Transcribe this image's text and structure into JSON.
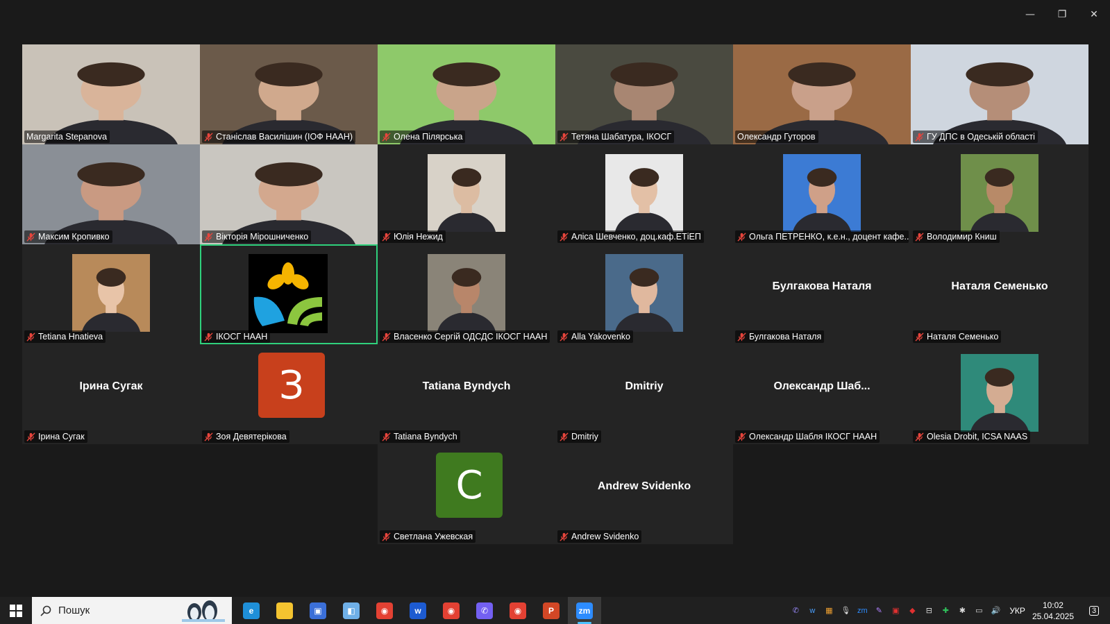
{
  "window": {
    "controls": [
      "minimize",
      "restore",
      "close"
    ]
  },
  "tiles": [
    {
      "row": 0,
      "col": 0,
      "name": "Margarita  Stepanova",
      "muted": false,
      "kind": "video",
      "bg": "#c9c2b8",
      "skin": "#d9b49a"
    },
    {
      "row": 0,
      "col": 1,
      "name": "Станіслав Василішин (ІОФ НААН)",
      "muted": true,
      "kind": "video",
      "bg": "#6b5a4a",
      "skin": "#d0a98d"
    },
    {
      "row": 0,
      "col": 2,
      "name": "Олена Пілярська",
      "muted": true,
      "kind": "video",
      "bg": "#8ec96a",
      "skin": "#c9a48a"
    },
    {
      "row": 0,
      "col": 3,
      "name": "Тетяна Шабатура, ІКОСГ",
      "muted": true,
      "kind": "video",
      "bg": "#4a4a40",
      "skin": "#a88672"
    },
    {
      "row": 0,
      "col": 4,
      "name": "Олександр Гуторов",
      "muted": false,
      "kind": "video",
      "bg": "#9a6a45",
      "skin": "#c9a08a"
    },
    {
      "row": 0,
      "col": 5,
      "name": "ГУ ДПС в Одеській області",
      "muted": true,
      "kind": "video",
      "bg": "#cfd6df",
      "skin": "#b58e78"
    },
    {
      "row": 1,
      "col": 0,
      "name": "Максим Кропивко",
      "muted": true,
      "kind": "video",
      "bg": "#8a8f96",
      "skin": "#c99a82"
    },
    {
      "row": 1,
      "col": 1,
      "name": "Вікторія Мірошниченко",
      "muted": true,
      "kind": "video",
      "bg": "#c9c6c0",
      "skin": "#d3a88e"
    },
    {
      "row": 1,
      "col": 2,
      "name": "Юлія Нежид",
      "muted": true,
      "kind": "photo",
      "bg": "#d8d2c8",
      "skin": "#dcbca2"
    },
    {
      "row": 1,
      "col": 3,
      "name": "Аліса Шевченко, доц.каф.ЕТіЕП",
      "muted": true,
      "kind": "photo",
      "bg": "#e8e8e8",
      "skin": "#e3c0a6"
    },
    {
      "row": 1,
      "col": 4,
      "name": "Ольга ПЕТРЕНКО, к.е.н., доцент кафе...",
      "muted": true,
      "kind": "photo",
      "bg": "#3c7bd4",
      "skin": "#cfa088"
    },
    {
      "row": 1,
      "col": 5,
      "name": "Володимир Книш",
      "muted": true,
      "kind": "photo",
      "bg": "#6f8f4a",
      "skin": "#b88a68"
    },
    {
      "row": 2,
      "col": 0,
      "name": "Tetiana Hnatieva",
      "muted": true,
      "kind": "photo",
      "bg": "#b88a5a",
      "skin": "#e8c4a8"
    },
    {
      "row": 2,
      "col": 1,
      "name": "ІКОСГ НААН",
      "muted": true,
      "kind": "logo",
      "active": true
    },
    {
      "row": 2,
      "col": 2,
      "name": "Власенко Сергій ОДСДС ІКОСГ НААН",
      "muted": true,
      "kind": "photo",
      "bg": "#8a8478",
      "skin": "#b8866a"
    },
    {
      "row": 2,
      "col": 3,
      "name": "Alla Yakovenko",
      "muted": true,
      "kind": "photo",
      "bg": "#4a6a8a",
      "skin": "#e0b89e"
    },
    {
      "row": 2,
      "col": 4,
      "name": "Булгакова Наталя",
      "muted": true,
      "kind": "name",
      "display": "Булгакова Наталя"
    },
    {
      "row": 2,
      "col": 5,
      "name": "Наталя Семенько",
      "muted": true,
      "kind": "name",
      "display": "Наталя Семенько"
    },
    {
      "row": 3,
      "col": 0,
      "name": "Ірина Сугак",
      "muted": true,
      "kind": "name",
      "display": "Ірина Сугак"
    },
    {
      "row": 3,
      "col": 1,
      "name": "Зоя Девятерікова",
      "muted": true,
      "kind": "avatar",
      "letter": "З",
      "avatar_color": "#c8401c"
    },
    {
      "row": 3,
      "col": 2,
      "name": "Tatiana Byndych",
      "muted": true,
      "kind": "name",
      "display": "Tatiana Byndych"
    },
    {
      "row": 3,
      "col": 3,
      "name": "Dmitriy",
      "muted": true,
      "kind": "name",
      "display": "Dmitriy"
    },
    {
      "row": 3,
      "col": 4,
      "name": "Олександр Шабля ІКОСГ НААН",
      "muted": true,
      "kind": "name",
      "display": "Олександр  Шаб..."
    },
    {
      "row": 3,
      "col": 5,
      "name": "Olesia Drobit, ICSA NAAS",
      "muted": true,
      "kind": "photo",
      "bg": "#2f8a7a",
      "skin": "#d4ac92"
    },
    {
      "row": 4,
      "col": 2,
      "name": "Светлана Ужевская",
      "muted": true,
      "kind": "avatar",
      "letter": "С",
      "avatar_color": "#3f7a1f"
    },
    {
      "row": 4,
      "col": 3,
      "name": "Andrew Svidenko",
      "muted": true,
      "kind": "name",
      "display": "Andrew Svidenko"
    }
  ],
  "taskbar": {
    "search_placeholder": "Пошук",
    "apps": [
      {
        "name": "edge-icon",
        "color": "#1f8fd8",
        "glyph": "e"
      },
      {
        "name": "file-explorer-icon",
        "color": "#f4c430",
        "glyph": ""
      },
      {
        "name": "save-app-icon",
        "color": "#3b6fd8",
        "glyph": "▣"
      },
      {
        "name": "notes-app-icon",
        "color": "#6fb0e8",
        "glyph": "◧"
      },
      {
        "name": "chrome-icon",
        "color": "#e34133",
        "glyph": "◉"
      },
      {
        "name": "webex-icon",
        "color": "#1d5bd1",
        "glyph": "w"
      },
      {
        "name": "chrome-profile-icon",
        "color": "#e34133",
        "glyph": "◉"
      },
      {
        "name": "viber-icon",
        "color": "#7360f2",
        "glyph": "✆"
      },
      {
        "name": "chrome-profile2-icon",
        "color": "#e34133",
        "glyph": "◉"
      },
      {
        "name": "powerpoint-icon",
        "color": "#d24726",
        "glyph": "P"
      },
      {
        "name": "zoom-icon",
        "color": "#2d8cff",
        "glyph": "zm",
        "active": true
      }
    ],
    "language": "УКР",
    "time": "10:02",
    "date": "25.04.2025",
    "notifications": "3"
  }
}
